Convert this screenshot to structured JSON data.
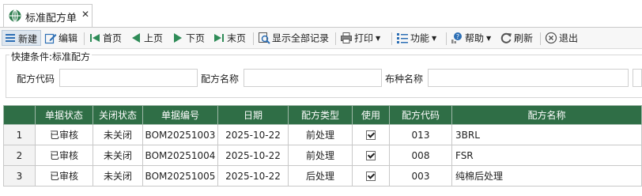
{
  "tab": {
    "title": "标准配方单",
    "close": "✕"
  },
  "toolbar": {
    "new": "新建",
    "edit": "编辑",
    "first": "首页",
    "prev": "上页",
    "next": "下页",
    "last": "末页",
    "show_all": "显示全部记录",
    "print": "打印",
    "function": "功能",
    "help": "帮助",
    "refresh": "刷新",
    "exit": "退出"
  },
  "filter": {
    "legend": "快捷条件:标准配方",
    "fields": [
      {
        "label": "配方代码",
        "value": ""
      },
      {
        "label": "配方名称",
        "value": ""
      },
      {
        "label": "布种名称",
        "value": ""
      }
    ]
  },
  "grid": {
    "columns": [
      "",
      "单据状态",
      "关闭状态",
      "单据编号",
      "日期",
      "配方类型",
      "使用",
      "配方代码",
      "配方名称"
    ],
    "rows": [
      {
        "no": "1",
        "status": "已审核",
        "close": "未关闭",
        "doc_no": "BOM20251003",
        "date": "2025-10-22",
        "type": "前处理",
        "used": true,
        "code": "013",
        "name": "3BRL"
      },
      {
        "no": "2",
        "status": "已审核",
        "close": "未关闭",
        "doc_no": "BOM20251004",
        "date": "2025-10-22",
        "type": "前处理",
        "used": true,
        "code": "008",
        "name": "FSR"
      },
      {
        "no": "3",
        "status": "已审核",
        "close": "未关闭",
        "doc_no": "BOM20251005",
        "date": "2025-10-22",
        "type": "后处理",
        "used": true,
        "code": "003",
        "name": "纯棉后处理"
      }
    ]
  },
  "colors": {
    "header_green": "#2f6e46",
    "accent_blue": "#2d6fb5"
  }
}
